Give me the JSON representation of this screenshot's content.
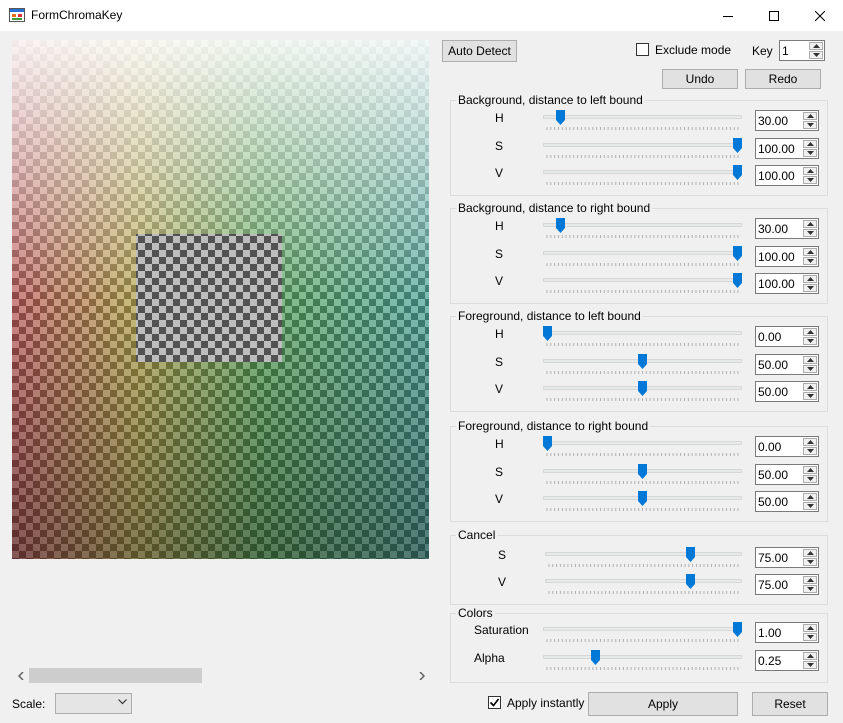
{
  "window": {
    "title": "FormChromaKey"
  },
  "toolbar": {
    "auto_detect": "Auto Detect",
    "exclude_mode": "Exclude mode",
    "exclude_checked": false,
    "key_label": "Key",
    "key_value": "1",
    "undo": "Undo",
    "redo": "Redo"
  },
  "groups": [
    {
      "title": "Background, distance to left bound",
      "rows": [
        {
          "label": "H",
          "value": "30.00",
          "fraction": 0.07
        },
        {
          "label": "S",
          "value": "100.00",
          "fraction": 1.0
        },
        {
          "label": "V",
          "value": "100.00",
          "fraction": 1.0
        }
      ]
    },
    {
      "title": "Background, distance to right bound",
      "rows": [
        {
          "label": "H",
          "value": "30.00",
          "fraction": 0.07
        },
        {
          "label": "S",
          "value": "100.00",
          "fraction": 1.0
        },
        {
          "label": "V",
          "value": "100.00",
          "fraction": 1.0
        }
      ]
    },
    {
      "title": "Foreground, distance to left bound",
      "rows": [
        {
          "label": "H",
          "value": "0.00",
          "fraction": 0.0
        },
        {
          "label": "S",
          "value": "50.00",
          "fraction": 0.5
        },
        {
          "label": "V",
          "value": "50.00",
          "fraction": 0.5
        }
      ]
    },
    {
      "title": "Foreground, distance to right bound",
      "rows": [
        {
          "label": "H",
          "value": "0.00",
          "fraction": 0.0
        },
        {
          "label": "S",
          "value": "50.00",
          "fraction": 0.5
        },
        {
          "label": "V",
          "value": "50.00",
          "fraction": 0.5
        }
      ]
    },
    {
      "title": "Cancel",
      "rows": [
        {
          "label": "S",
          "value": "75.00",
          "fraction": 0.75
        },
        {
          "label": "V",
          "value": "75.00",
          "fraction": 0.75
        }
      ]
    },
    {
      "title": "Colors",
      "rows": [
        {
          "label": "Saturation",
          "value": "1.00",
          "fraction": 1.0
        },
        {
          "label": "Alpha",
          "value": "0.25",
          "fraction": 0.25
        }
      ]
    }
  ],
  "bottom": {
    "scale_label": "Scale:",
    "scale_value": "",
    "apply_instantly": "Apply instantly",
    "apply_instantly_checked": true,
    "apply": "Apply",
    "reset": "Reset"
  },
  "colors": {
    "slider_thumb": "#0078d7",
    "title_bar": "#ffffff",
    "window_bg": "#f0f0f0"
  },
  "icons": {
    "app": "form-icon",
    "minimize": "minimize-icon",
    "maximize": "maximize-icon",
    "close": "close-icon"
  }
}
